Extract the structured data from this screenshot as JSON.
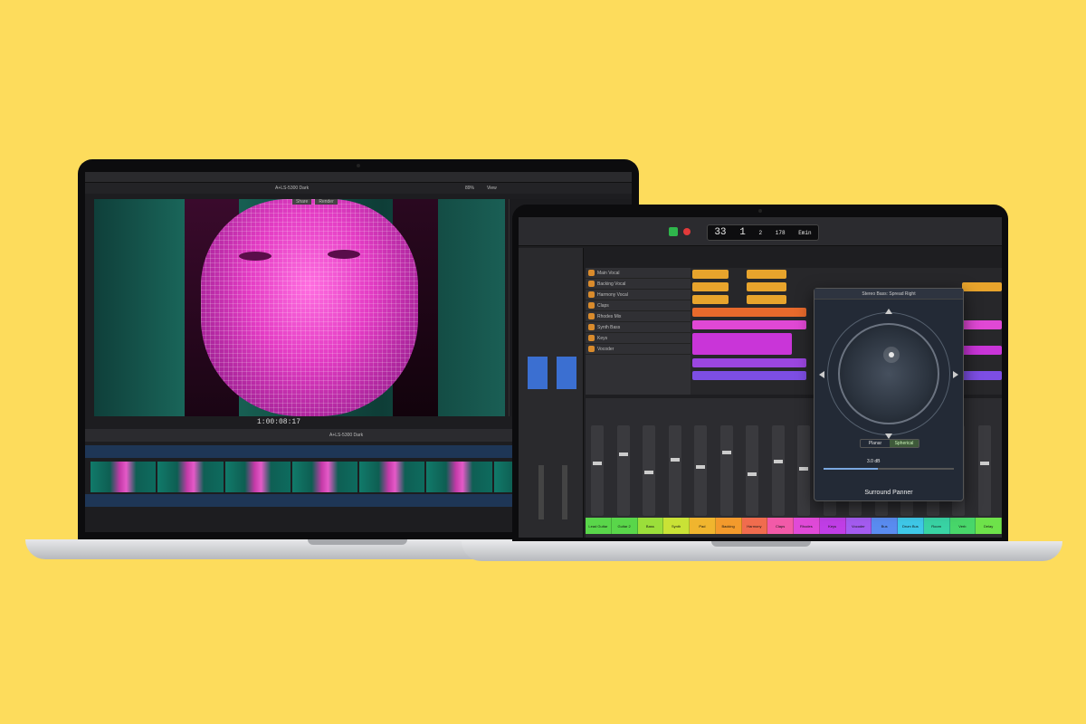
{
  "left_app": {
    "window_title": "A+LS-5300 Dark",
    "zoom": "89%",
    "view_label": "View",
    "viewer_buttons": [
      "Share",
      "Render"
    ],
    "timecode": "1:00:08:17",
    "timeline_label": "A+LS-5300 Dark"
  },
  "right_app": {
    "lcd": {
      "bar": "33",
      "beat": "1",
      "division": "2",
      "tick": "178",
      "key": "Emin"
    },
    "panner": {
      "title": "Surround Panner",
      "header": "Stereo Bass: Spread Right",
      "modes": [
        "Planar",
        "Spherical"
      ],
      "active_mode": "Spherical",
      "spread_value": "3.0 dB"
    },
    "tracks": [
      "Main Vocal",
      "Backing Vocal",
      "Harmony Vocal",
      "Claps",
      "Rhodes Mix",
      "Synth Bass",
      "Keys",
      "Vocoder"
    ],
    "mixer_labels": [
      {
        "text": "Lead Guitar",
        "color": "#59d64a"
      },
      {
        "text": "Guitar 2",
        "color": "#59d64a"
      },
      {
        "text": "Bass",
        "color": "#9bde3a"
      },
      {
        "text": "Synth",
        "color": "#c9e236"
      },
      {
        "text": "Pad",
        "color": "#f0b52e"
      },
      {
        "text": "Backing",
        "color": "#f39a2c"
      },
      {
        "text": "Harmony",
        "color": "#f06c4e"
      },
      {
        "text": "Claps",
        "color": "#f25aa8"
      },
      {
        "text": "Rhodes",
        "color": "#e04ad8"
      },
      {
        "text": "Keys",
        "color": "#c03ee6"
      },
      {
        "text": "Vocoder",
        "color": "#a45cf0"
      },
      {
        "text": "Bus",
        "color": "#5a8cf0"
      },
      {
        "text": "Drum Bus",
        "color": "#3fc8e8"
      },
      {
        "text": "Room",
        "color": "#39d3a4"
      },
      {
        "text": "Verb",
        "color": "#48d66a"
      },
      {
        "text": "Delay",
        "color": "#6ee24a"
      }
    ]
  }
}
